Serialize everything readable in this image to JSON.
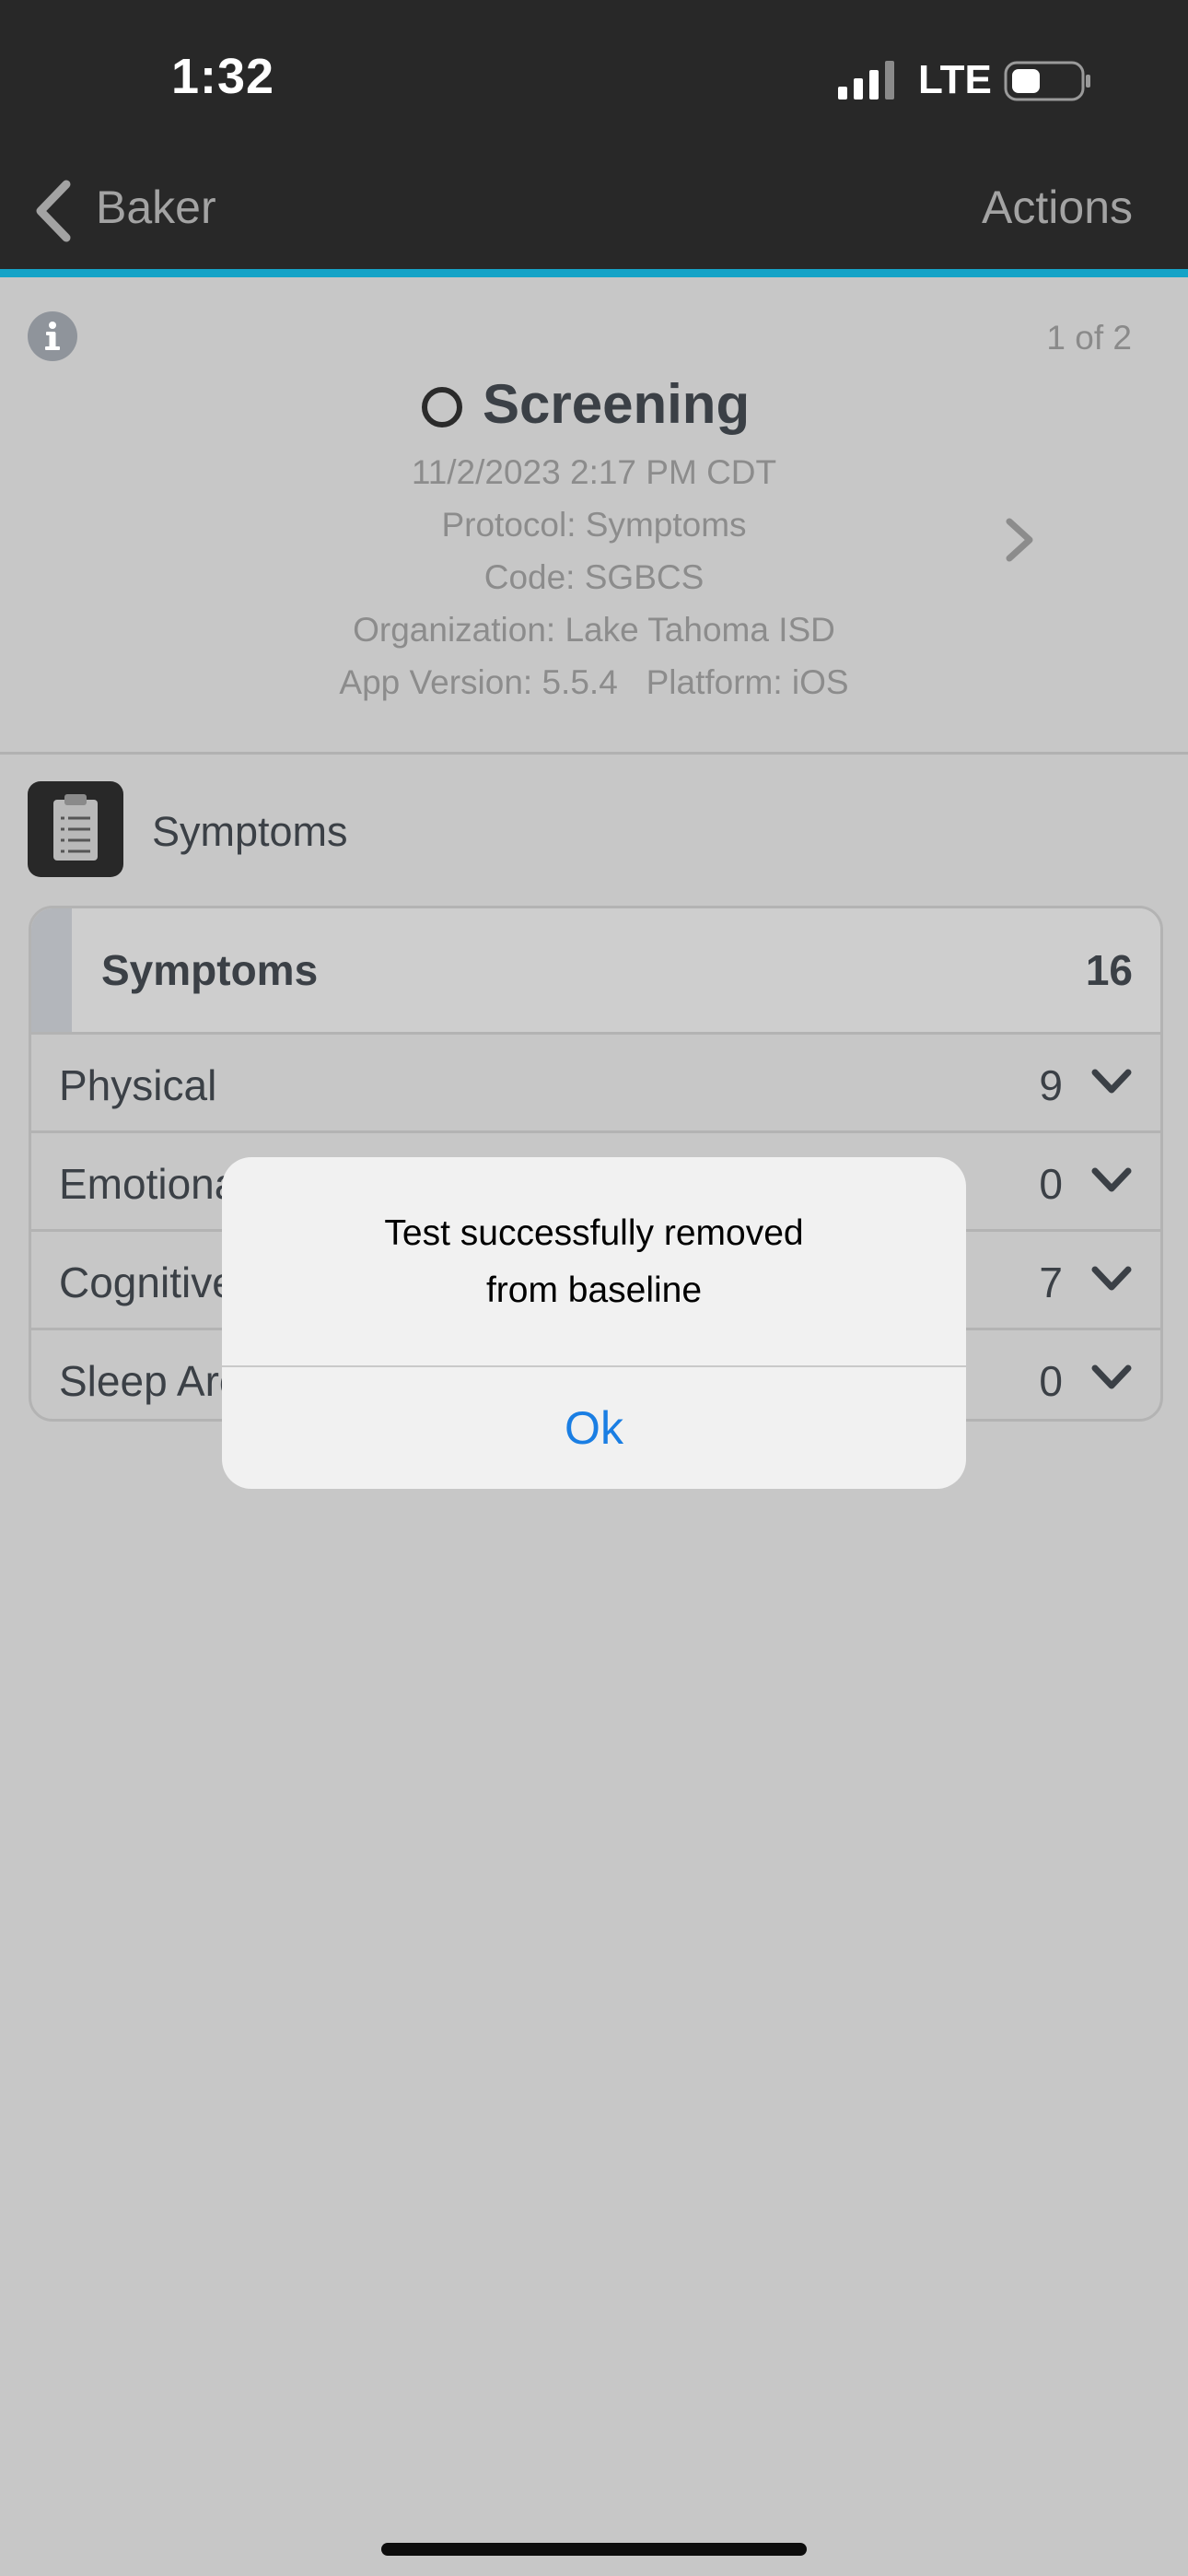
{
  "status_bar": {
    "time": "1:32",
    "network": "LTE"
  },
  "nav": {
    "back_label": "Baker",
    "actions_label": "Actions"
  },
  "header": {
    "page_indicator": "1 of 2",
    "title": "Screening",
    "datetime": "11/2/2023 2:17 PM CDT",
    "protocol": "Protocol: Symptoms",
    "code": "Code: SGBCS",
    "organization": "Organization: Lake Tahoma ISD",
    "app_version": "App Version: 5.5.4   Platform: iOS"
  },
  "section": {
    "title": "Symptoms"
  },
  "card": {
    "title": "Symptoms",
    "total": "16",
    "rows": [
      {
        "label": "Physical",
        "value": "9"
      },
      {
        "label": "Emotional",
        "value": "0"
      },
      {
        "label": "Cognitive",
        "value": "7"
      },
      {
        "label": "Sleep Arousal",
        "value": "0"
      }
    ]
  },
  "alert": {
    "message_line1": "Test successfully removed",
    "message_line2": "from baseline",
    "ok_label": "Ok"
  },
  "colors": {
    "accent": "#15a3c7",
    "alert_button": "#1a7ee3",
    "nav_background": "#282828"
  }
}
